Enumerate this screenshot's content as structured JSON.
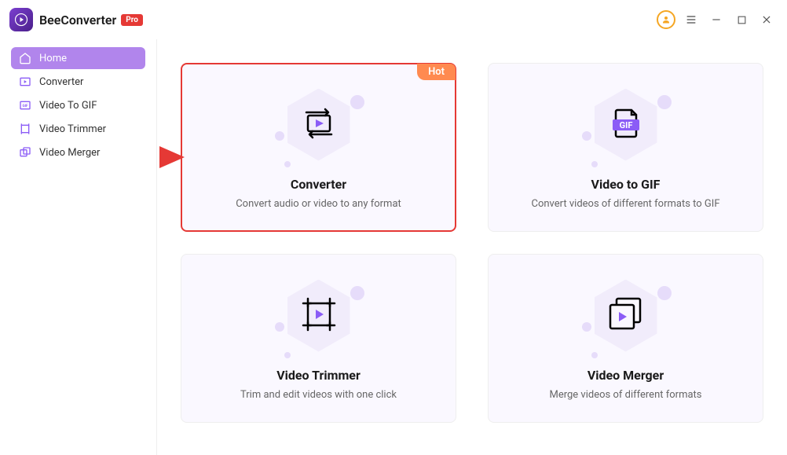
{
  "app": {
    "name": "BeeConverter",
    "badge": "Pro"
  },
  "sidebar": {
    "items": [
      {
        "label": "Home"
      },
      {
        "label": "Converter"
      },
      {
        "label": "Video To GIF"
      },
      {
        "label": "Video Trimmer"
      },
      {
        "label": "Video Merger"
      }
    ]
  },
  "cards": {
    "converter": {
      "title": "Converter",
      "desc": "Convert audio or video to any format",
      "badge": "Hot"
    },
    "videotogif": {
      "title": "Video to GIF",
      "desc": "Convert videos of different formats to GIF",
      "gif_label": "GIF"
    },
    "trimmer": {
      "title": "Video Trimmer",
      "desc": "Trim and edit videos with one click"
    },
    "merger": {
      "title": "Video Merger",
      "desc": "Merge videos of different formats"
    }
  }
}
